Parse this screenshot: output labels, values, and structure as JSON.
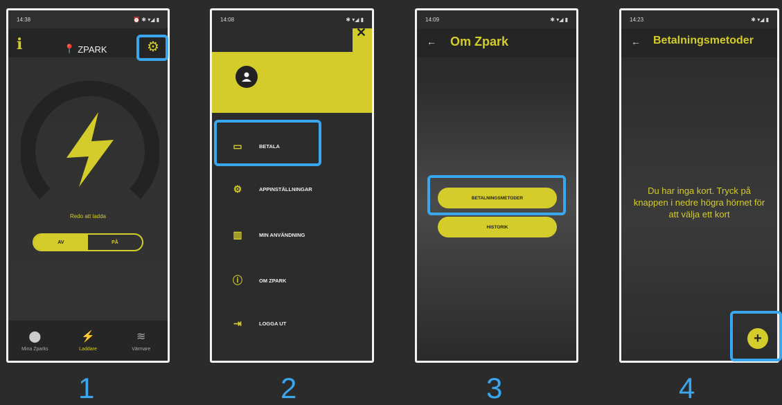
{
  "colors": {
    "accent": "#d4cc2a",
    "highlight": "#3aa6ee",
    "background": "#2b2b2b"
  },
  "steps": [
    "1",
    "2",
    "3",
    "4"
  ],
  "phone1": {
    "status_time": "14:38",
    "location": "ZPARK",
    "ready_text": "Redo att ladda",
    "toggle_off": "AV",
    "toggle_on": "PÅ",
    "nav": [
      {
        "label": "Mina Zparks",
        "icon": "map-pin-icon"
      },
      {
        "label": "Laddare",
        "icon": "lightning-icon"
      },
      {
        "label": "Värmare",
        "icon": "heat-icon"
      }
    ]
  },
  "phone2": {
    "status_time": "14:08",
    "menu": [
      {
        "label": "BETALA",
        "icon": "card-icon"
      },
      {
        "label": "APPINSTÄLLNINGAR",
        "icon": "gear-icon"
      },
      {
        "label": "MIN ANVÄNDNING",
        "icon": "chart-icon"
      },
      {
        "label": "OM ZPARK",
        "icon": "info-icon"
      },
      {
        "label": "LOGGA UT",
        "icon": "logout-icon"
      }
    ]
  },
  "phone3": {
    "status_time": "14:09",
    "title": "Om Zpark",
    "btn_payment_methods": "BETALNINGSMETODER",
    "btn_history": "HISTORIK"
  },
  "phone4": {
    "status_time": "14:23",
    "title": "Betalningsmetoder",
    "empty_message": "Du har inga kort. Tryck på knappen i nedre högra hörnet för att välja ett kort"
  }
}
